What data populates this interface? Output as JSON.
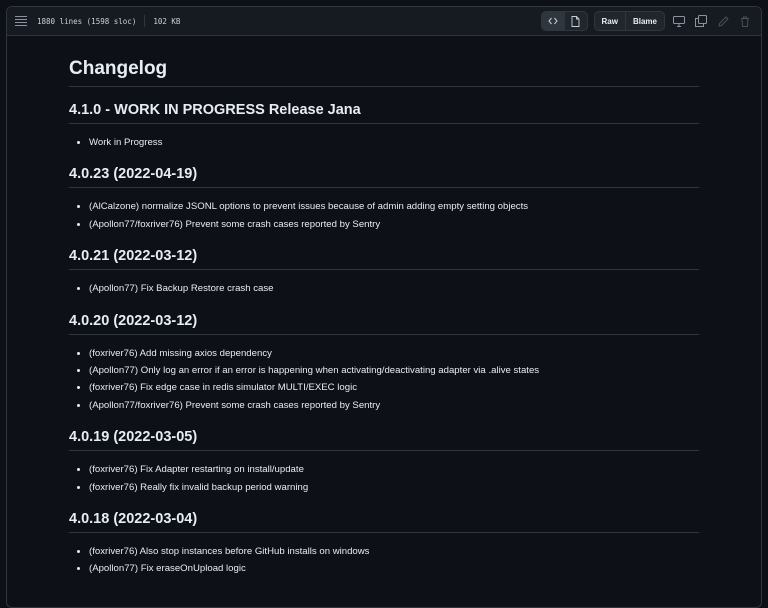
{
  "toolbar": {
    "lines_info": "1880 lines (1598 sloc)",
    "size": "102 KB",
    "raw_label": "Raw",
    "blame_label": "Blame"
  },
  "doc": {
    "title": "Changelog",
    "sections": [
      {
        "heading": "4.1.0 - WORK IN PROGRESS Release Jana",
        "items": [
          "Work in Progress"
        ]
      },
      {
        "heading": "4.0.23 (2022-04-19)",
        "items": [
          "(AlCalzone) normalize JSONL options to prevent issues because of admin adding empty setting objects",
          "(Apollon77/foxriver76) Prevent some crash cases reported by Sentry"
        ]
      },
      {
        "heading": "4.0.21 (2022-03-12)",
        "items": [
          "(Apollon77) Fix Backup Restore crash case"
        ]
      },
      {
        "heading": "4.0.20 (2022-03-12)",
        "items": [
          "(foxriver76) Add missing axios dependency",
          "(Apollon77) Only log an error if an error is happening when activating/deactivating adapter via .alive states",
          "(foxriver76) Fix edge case in redis simulator MULTI/EXEC logic",
          "(Apollon77/foxriver76) Prevent some crash cases reported by Sentry"
        ]
      },
      {
        "heading": "4.0.19 (2022-03-05)",
        "items": [
          "(foxriver76) Fix Adapter restarting on install/update",
          "(foxriver76) Really fix invalid backup period warning"
        ]
      },
      {
        "heading": "4.0.18 (2022-03-04)",
        "items": [
          "(foxriver76) Also stop instances before GitHub installs on windows",
          "(Apollon77) Fix eraseOnUpload logic"
        ]
      }
    ]
  }
}
